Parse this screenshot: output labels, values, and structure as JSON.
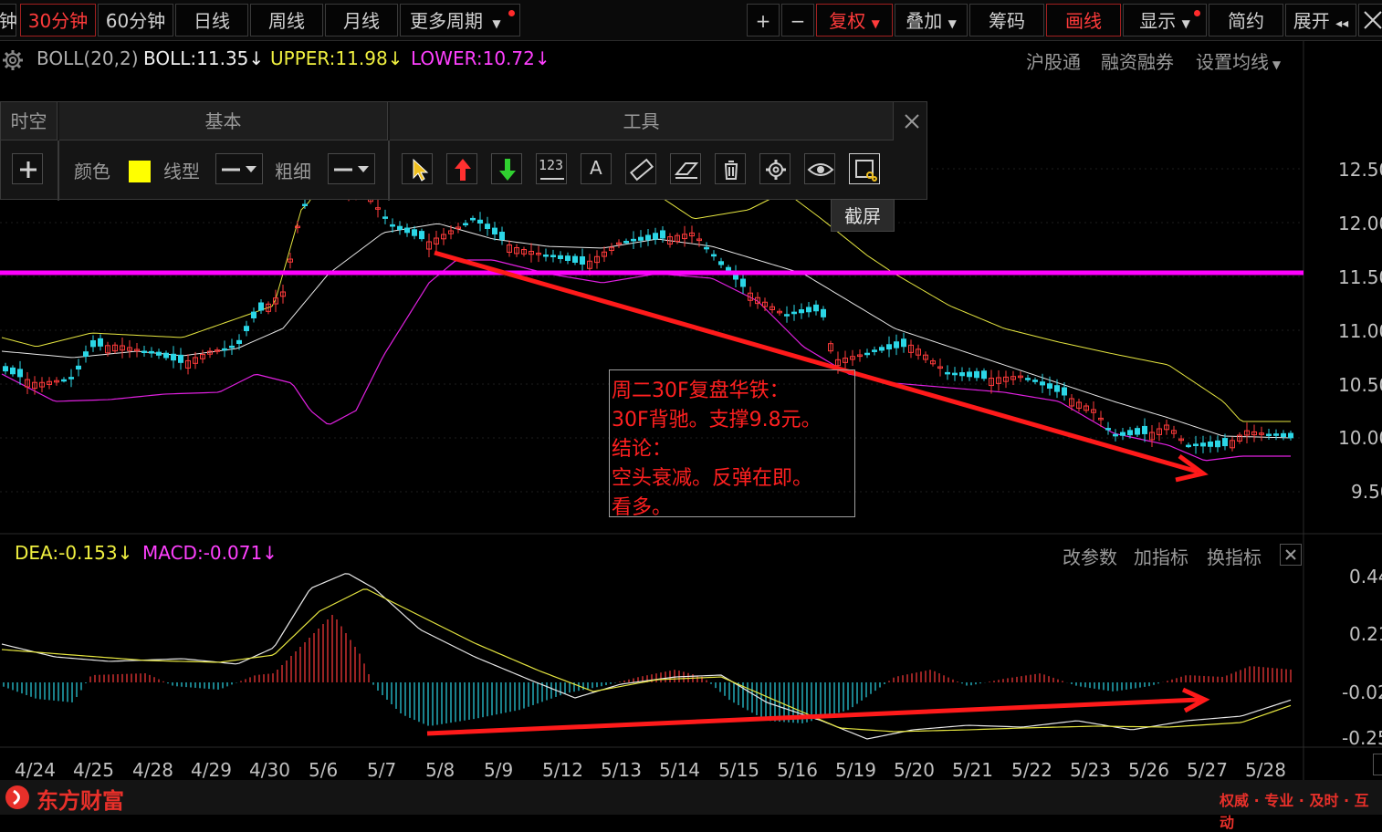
{
  "periods": [
    "钟",
    "30分钟",
    "60分钟",
    "日线",
    "周线",
    "月线",
    "更多周期"
  ],
  "active_period": "30分钟",
  "right_buttons": {
    "plus": "+",
    "minus": "−",
    "fuquan": "复权",
    "diejia": "叠加",
    "chouma": "筹码",
    "huaxian": "画线",
    "xianshi": "显示",
    "jianyue": "简约",
    "zhankai": "展开"
  },
  "boll": {
    "name": "BOLL(20,2)",
    "boll": "BOLL:11.35",
    "upper": "UPPER:11.98",
    "lower": "LOWER:10.72",
    "arrow": "↓"
  },
  "top_links": [
    "沪股通",
    "融资融券",
    "设置均线"
  ],
  "panel": {
    "tabs": [
      "时空",
      "基本",
      "工具"
    ],
    "color_label": "颜色",
    "line_type_label": "线型",
    "thickness_label": "粗细",
    "tool_123": "123",
    "tool_text": "A",
    "tooltip": "截屏"
  },
  "price_axis": [
    "12.50",
    "12.00",
    "11.50",
    "11.00",
    "10.50",
    "10.00",
    "9.50"
  ],
  "note": {
    "lines": [
      "周二30F复盘华铁：",
      "30F背驰。支撑9.8元。",
      "结论：",
      "空头衰减。反弹在即。",
      "看多。"
    ]
  },
  "macd": {
    "dea": "DEA:-0.153",
    "macd": "MACD:-0.071",
    "arrow": "↓",
    "links": [
      "改参数",
      "加指标",
      "换指标"
    ],
    "axis": [
      "0.44",
      "0.21",
      "-0.02",
      "-0.25"
    ]
  },
  "dates": [
    "4/24",
    "4/25",
    "4/28",
    "4/29",
    "4/30",
    "5/6",
    "5/7",
    "5/8",
    "5/9",
    "5/12",
    "5/13",
    "5/14",
    "5/15",
    "5/16",
    "5/19",
    "5/20",
    "5/21",
    "5/22",
    "5/23",
    "5/26",
    "5/27",
    "5/28"
  ],
  "brand": "东方财富",
  "slogan": "权威 · 专业 · 及时 · 互动",
  "colors": {
    "up": "#ff3b3b",
    "down": "#2bd6e6",
    "upper": "#e6e640",
    "lower": "#e020e0",
    "mid": "#e8e8e8",
    "hline": "#ff00ff",
    "arrow": "#ff1a1a"
  }
}
